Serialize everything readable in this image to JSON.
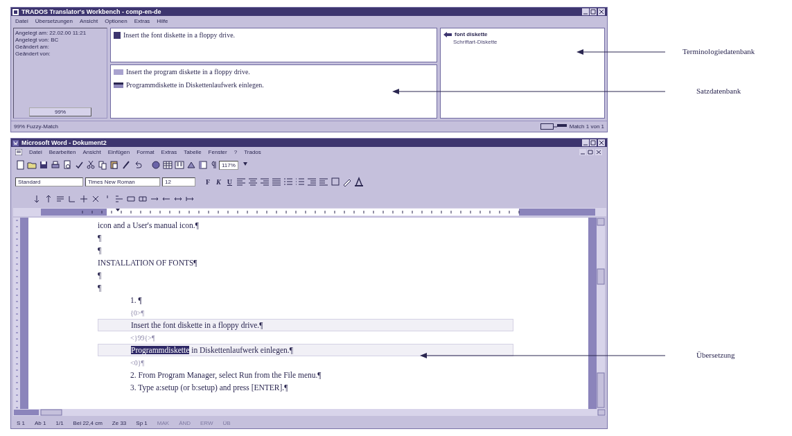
{
  "workbench": {
    "title": "TRADOS Translator's Workbench - comp-en-de",
    "menu": [
      "Datei",
      "Übersetzungen",
      "Ansicht",
      "Optionen",
      "Extras",
      "Hilfe"
    ],
    "info": [
      "Angelegt am: 22.02.00 11:21",
      "Angelegt von: BC",
      "Geändert am:",
      "Geändert von:"
    ],
    "match_value": "99%",
    "source": "Insert the font diskette in a floppy drive.",
    "tm_source": "Insert the program diskette in a floppy drive.",
    "tm_target": "Programmdiskette in Diskettenlaufwerk einlegen.",
    "terms": [
      {
        "kind": "term",
        "text": "font diskette"
      },
      {
        "kind": "translation",
        "text": "Schriftart-Diskette"
      }
    ],
    "status": "99% Fuzzy-Match",
    "status_right": "Match 1 von 1"
  },
  "word": {
    "title": "Microsoft Word - Dokument2",
    "menu": [
      "Datei",
      "Bearbeiten",
      "Ansicht",
      "Einfügen",
      "Format",
      "Extras",
      "Tabelle",
      "Fenster",
      "?",
      "Trados"
    ],
    "style": "Standard",
    "font": "Times New Roman",
    "size": "12",
    "zoom": "117%",
    "format_buttons": [
      "F",
      "K",
      "U"
    ],
    "lines": [
      {
        "kind": "body",
        "text": "icon and a User's manual icon.¶"
      },
      {
        "kind": "body",
        "text": "¶"
      },
      {
        "kind": "body",
        "text": "¶"
      },
      {
        "kind": "body",
        "text": "INSTALLATION OF FONTS¶"
      },
      {
        "kind": "body",
        "text": "¶"
      },
      {
        "kind": "body",
        "text": "¶"
      },
      {
        "kind": "list",
        "text": "1. ¶"
      },
      {
        "kind": "tag",
        "text": "{0>¶"
      },
      {
        "kind": "source",
        "text": "Insert the font diskette in a floppy drive.¶"
      },
      {
        "kind": "tag",
        "text": "<}99{>¶"
      },
      {
        "kind": "target",
        "selection": "Programmdiskette",
        "text": " in Diskettenlaufwerk einlegen.¶"
      },
      {
        "kind": "tag",
        "text": "<0}¶"
      },
      {
        "kind": "list",
        "text": "2. From Program Manager, select Run from the File menu.¶"
      },
      {
        "kind": "list",
        "text": "3. Type a:setup (or b:setup) and press [ENTER].¶"
      }
    ],
    "status": [
      "S 1",
      "Ab 1",
      "1/1",
      "Bei 22,4 cm",
      "Ze 33",
      "Sp 1",
      "MAK",
      "ÄND",
      "ERW",
      "ÜB"
    ]
  },
  "callouts": [
    {
      "label": "Terminologiedatenbank"
    },
    {
      "label": "Satzdatenbank"
    },
    {
      "label": "Übersetzung"
    }
  ]
}
